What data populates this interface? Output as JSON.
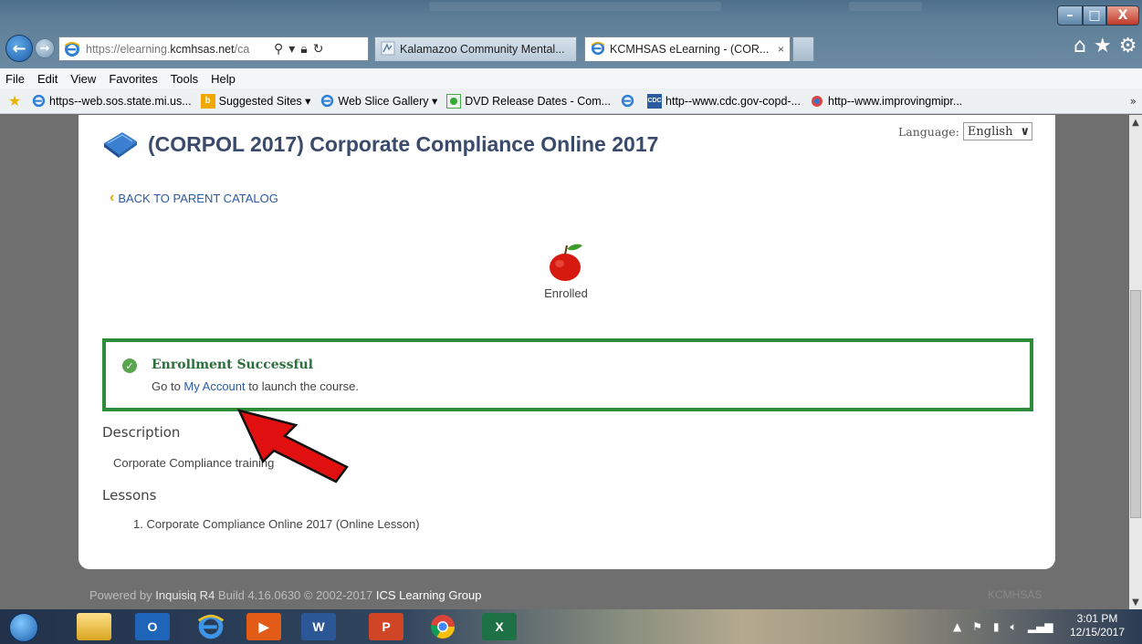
{
  "browser": {
    "url_prefix": "https://elearning.",
    "url_domain": "kcmhsas.net",
    "url_suffix": "/ca",
    "tabs": [
      {
        "label": "Kalamazoo Community Mental..."
      },
      {
        "label": "KCMHSAS eLearning - (COR..."
      }
    ],
    "tab_close": "×",
    "menu": [
      "File",
      "Edit",
      "View",
      "Favorites",
      "Tools",
      "Help"
    ],
    "favorites": [
      {
        "label": "https--web.sos.state.mi.us...",
        "icon": "ie-page-icon"
      },
      {
        "label": "Suggested Sites ▾",
        "icon": "bing-icon"
      },
      {
        "label": "Web Slice Gallery ▾",
        "icon": "ie-page-icon"
      },
      {
        "label": "DVD Release Dates - Com...",
        "icon": "green-dot-icon"
      },
      {
        "label": "",
        "icon": "ie-page-icon"
      },
      {
        "label": "http--www.cdc.gov-copd-...",
        "icon": "cdc-icon"
      },
      {
        "label": "http--www.improvingmipr...",
        "icon": "web-icon"
      }
    ],
    "favorites_overflow": "»",
    "window_buttons": {
      "minimize": "–",
      "maximize": "□",
      "close": "X"
    }
  },
  "page": {
    "language_label": "Language:",
    "language_value": "English",
    "title": "(CORPOL 2017) Corporate Compliance Online 2017",
    "back_link": "BACK TO PARENT CATALOG",
    "status_label": "Enrolled",
    "success": {
      "title": "Enrollment Successful",
      "msg_before": "Go to ",
      "msg_link": "My Account",
      "msg_after": " to launch the course."
    },
    "description_heading": "Description",
    "description_text": "Corporate Compliance training",
    "lessons_heading": "Lessons",
    "lessons": [
      "1.  Corporate Compliance Online 2017 (Online Lesson)"
    ]
  },
  "footer": {
    "powered_by": "Powered by ",
    "product": "Inquisiq R4",
    "build": " Build 4.16.0630  © 2002-2017  ",
    "company": "ICS Learning Group",
    "brand": "KCMHSAS"
  },
  "taskbar": {
    "apps": [
      "outlook",
      "internet-explorer",
      "media",
      "word",
      "powerpoint",
      "chrome",
      "excel"
    ],
    "time": "3:01 PM",
    "date": "12/15/2017"
  },
  "colors": {
    "success_border": "#2e8b3a",
    "link": "#2b5aa0",
    "title": "#3a4a6b",
    "annotation_arrow": "#e01010"
  }
}
